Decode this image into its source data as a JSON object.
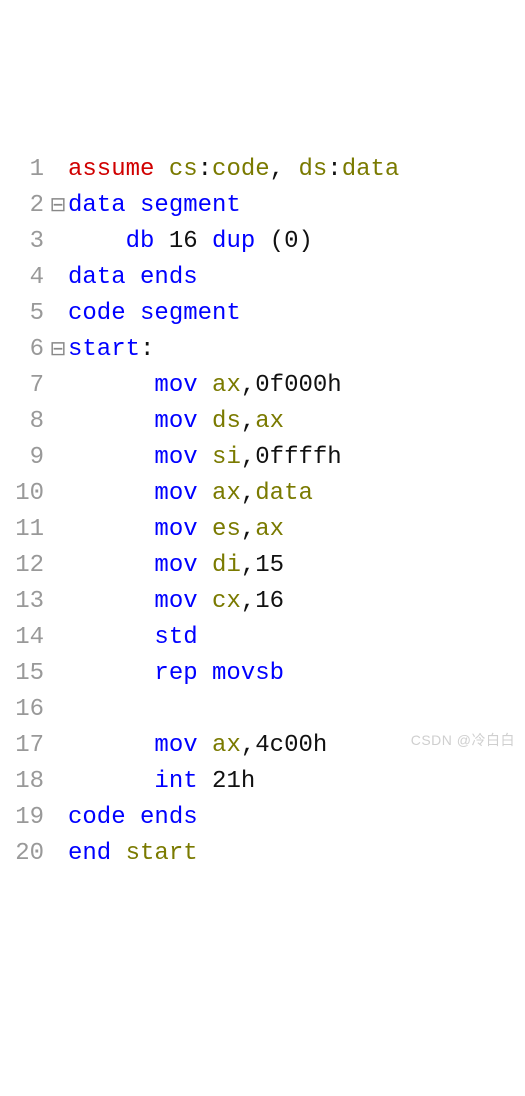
{
  "watermark": "CSDN @冷白白",
  "lines": [
    {
      "n": "1",
      "fold": "",
      "tokens": [
        {
          "cls": "kw-red",
          "t": "assume"
        },
        {
          "cls": "punct",
          "t": " "
        },
        {
          "cls": "ident",
          "t": "cs"
        },
        {
          "cls": "punct",
          "t": ":"
        },
        {
          "cls": "ident",
          "t": "code"
        },
        {
          "cls": "punct",
          "t": ", "
        },
        {
          "cls": "ident",
          "t": "ds"
        },
        {
          "cls": "punct",
          "t": ":"
        },
        {
          "cls": "ident",
          "t": "data"
        }
      ]
    },
    {
      "n": "2",
      "fold": "⊟",
      "tokens": [
        {
          "cls": "kw-blue",
          "t": "data segment"
        }
      ]
    },
    {
      "n": "3",
      "fold": "",
      "tokens": [
        {
          "cls": "punct",
          "t": "    "
        },
        {
          "cls": "kw-blue",
          "t": "db"
        },
        {
          "cls": "punct",
          "t": " "
        },
        {
          "cls": "num",
          "t": "16"
        },
        {
          "cls": "punct",
          "t": " "
        },
        {
          "cls": "kw-blue",
          "t": "dup"
        },
        {
          "cls": "punct",
          "t": " ("
        },
        {
          "cls": "num",
          "t": "0"
        },
        {
          "cls": "punct",
          "t": ")"
        }
      ]
    },
    {
      "n": "4",
      "fold": "",
      "tokens": [
        {
          "cls": "kw-blue",
          "t": "data ends"
        }
      ]
    },
    {
      "n": "5",
      "fold": "",
      "tokens": [
        {
          "cls": "kw-blue",
          "t": "code segment"
        }
      ]
    },
    {
      "n": "6",
      "fold": "⊟",
      "tokens": [
        {
          "cls": "kw-blue",
          "t": "start"
        },
        {
          "cls": "punct",
          "t": ":"
        }
      ]
    },
    {
      "n": "7",
      "fold": "",
      "tokens": [
        {
          "cls": "punct",
          "t": "      "
        },
        {
          "cls": "kw-blue",
          "t": "mov"
        },
        {
          "cls": "punct",
          "t": " "
        },
        {
          "cls": "ident",
          "t": "ax"
        },
        {
          "cls": "punct",
          "t": ","
        },
        {
          "cls": "num",
          "t": "0f000h"
        }
      ]
    },
    {
      "n": "8",
      "fold": "",
      "tokens": [
        {
          "cls": "punct",
          "t": "      "
        },
        {
          "cls": "kw-blue",
          "t": "mov"
        },
        {
          "cls": "punct",
          "t": " "
        },
        {
          "cls": "ident",
          "t": "ds"
        },
        {
          "cls": "punct",
          "t": ","
        },
        {
          "cls": "ident",
          "t": "ax"
        }
      ]
    },
    {
      "n": "9",
      "fold": "",
      "tokens": [
        {
          "cls": "punct",
          "t": "      "
        },
        {
          "cls": "kw-blue",
          "t": "mov"
        },
        {
          "cls": "punct",
          "t": " "
        },
        {
          "cls": "ident",
          "t": "si"
        },
        {
          "cls": "punct",
          "t": ","
        },
        {
          "cls": "num",
          "t": "0ffffh"
        }
      ]
    },
    {
      "n": "10",
      "fold": "",
      "tokens": [
        {
          "cls": "punct",
          "t": "      "
        },
        {
          "cls": "kw-blue",
          "t": "mov"
        },
        {
          "cls": "punct",
          "t": " "
        },
        {
          "cls": "ident",
          "t": "ax"
        },
        {
          "cls": "punct",
          "t": ","
        },
        {
          "cls": "ident",
          "t": "data"
        }
      ]
    },
    {
      "n": "11",
      "fold": "",
      "tokens": [
        {
          "cls": "punct",
          "t": "      "
        },
        {
          "cls": "kw-blue",
          "t": "mov"
        },
        {
          "cls": "punct",
          "t": " "
        },
        {
          "cls": "ident",
          "t": "es"
        },
        {
          "cls": "punct",
          "t": ","
        },
        {
          "cls": "ident",
          "t": "ax"
        }
      ]
    },
    {
      "n": "12",
      "fold": "",
      "tokens": [
        {
          "cls": "punct",
          "t": "      "
        },
        {
          "cls": "kw-blue",
          "t": "mov"
        },
        {
          "cls": "punct",
          "t": " "
        },
        {
          "cls": "ident",
          "t": "di"
        },
        {
          "cls": "punct",
          "t": ","
        },
        {
          "cls": "num",
          "t": "15"
        }
      ]
    },
    {
      "n": "13",
      "fold": "",
      "tokens": [
        {
          "cls": "punct",
          "t": "      "
        },
        {
          "cls": "kw-blue",
          "t": "mov"
        },
        {
          "cls": "punct",
          "t": " "
        },
        {
          "cls": "ident",
          "t": "cx"
        },
        {
          "cls": "punct",
          "t": ","
        },
        {
          "cls": "num",
          "t": "16"
        }
      ]
    },
    {
      "n": "14",
      "fold": "",
      "tokens": [
        {
          "cls": "punct",
          "t": "      "
        },
        {
          "cls": "kw-blue",
          "t": "std"
        }
      ]
    },
    {
      "n": "15",
      "fold": "",
      "tokens": [
        {
          "cls": "punct",
          "t": "      "
        },
        {
          "cls": "kw-blue",
          "t": "rep movsb"
        }
      ]
    },
    {
      "n": "16",
      "fold": "",
      "tokens": []
    },
    {
      "n": "17",
      "fold": "",
      "tokens": [
        {
          "cls": "punct",
          "t": "      "
        },
        {
          "cls": "kw-blue",
          "t": "mov"
        },
        {
          "cls": "punct",
          "t": " "
        },
        {
          "cls": "ident",
          "t": "ax"
        },
        {
          "cls": "punct",
          "t": ","
        },
        {
          "cls": "num",
          "t": "4c00h"
        }
      ]
    },
    {
      "n": "18",
      "fold": "",
      "tokens": [
        {
          "cls": "punct",
          "t": "      "
        },
        {
          "cls": "kw-blue",
          "t": "int"
        },
        {
          "cls": "punct",
          "t": " "
        },
        {
          "cls": "num",
          "t": "21h"
        }
      ]
    },
    {
      "n": "19",
      "fold": "",
      "tokens": [
        {
          "cls": "kw-blue",
          "t": "code ends"
        }
      ]
    },
    {
      "n": "20",
      "fold": "",
      "tokens": [
        {
          "cls": "kw-blue",
          "t": "end"
        },
        {
          "cls": "punct",
          "t": " "
        },
        {
          "cls": "ident",
          "t": "start"
        }
      ]
    }
  ]
}
